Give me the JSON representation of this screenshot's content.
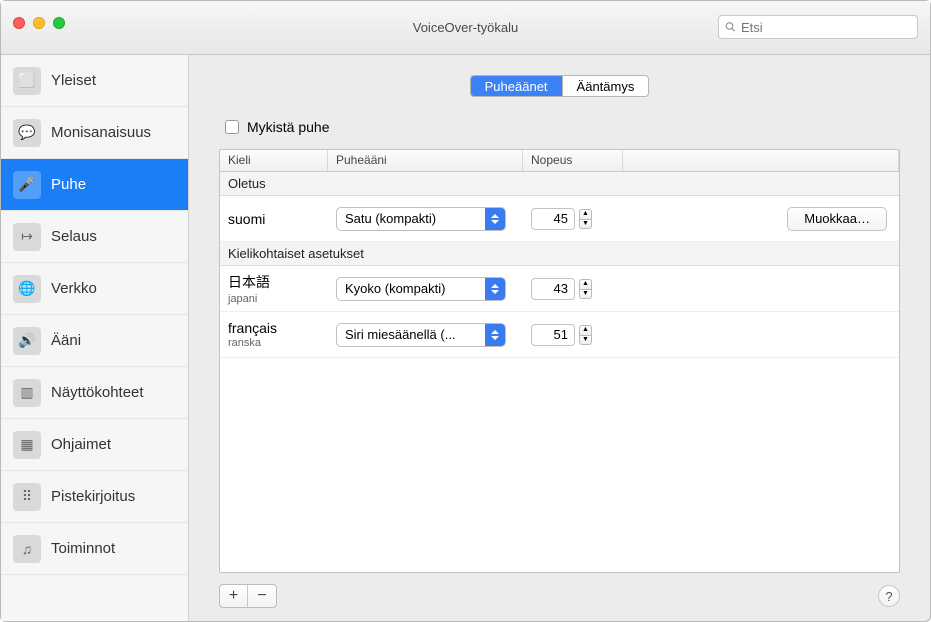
{
  "window": {
    "title": "VoiceOver-työkalu"
  },
  "search": {
    "placeholder": "Etsi"
  },
  "sidebar": {
    "items": [
      {
        "label": "Yleiset"
      },
      {
        "label": "Monisanaisuus"
      },
      {
        "label": "Puhe"
      },
      {
        "label": "Selaus"
      },
      {
        "label": "Verkko"
      },
      {
        "label": "Ääni"
      },
      {
        "label": "Näyttökohteet"
      },
      {
        "label": "Ohjaimet"
      },
      {
        "label": "Pistekirjoitus"
      },
      {
        "label": "Toiminnot"
      }
    ],
    "selected_index": 2
  },
  "tabs": {
    "items": [
      "Puheäänet",
      "Ääntämys"
    ],
    "active_index": 0
  },
  "mute": {
    "label": "Mykistä puhe",
    "checked": false
  },
  "table": {
    "columns": [
      "Kieli",
      "Puheääni",
      "Nopeus"
    ],
    "section_default": "Oletus",
    "section_lang": "Kielikohtaiset asetukset",
    "default_row": {
      "lang": "suomi",
      "voice": "Satu (kompakti)",
      "rate": 45,
      "button": "Muokkaa…"
    },
    "rows": [
      {
        "lang_native": "日本語",
        "lang_sub": "japani",
        "voice": "Kyoko (kompakti)",
        "rate": 43
      },
      {
        "lang_native": "français",
        "lang_sub": "ranska",
        "voice": "Siri miesäänellä (...",
        "rate": 51
      }
    ]
  },
  "footer": {
    "add": "+",
    "remove": "−",
    "help": "?"
  }
}
